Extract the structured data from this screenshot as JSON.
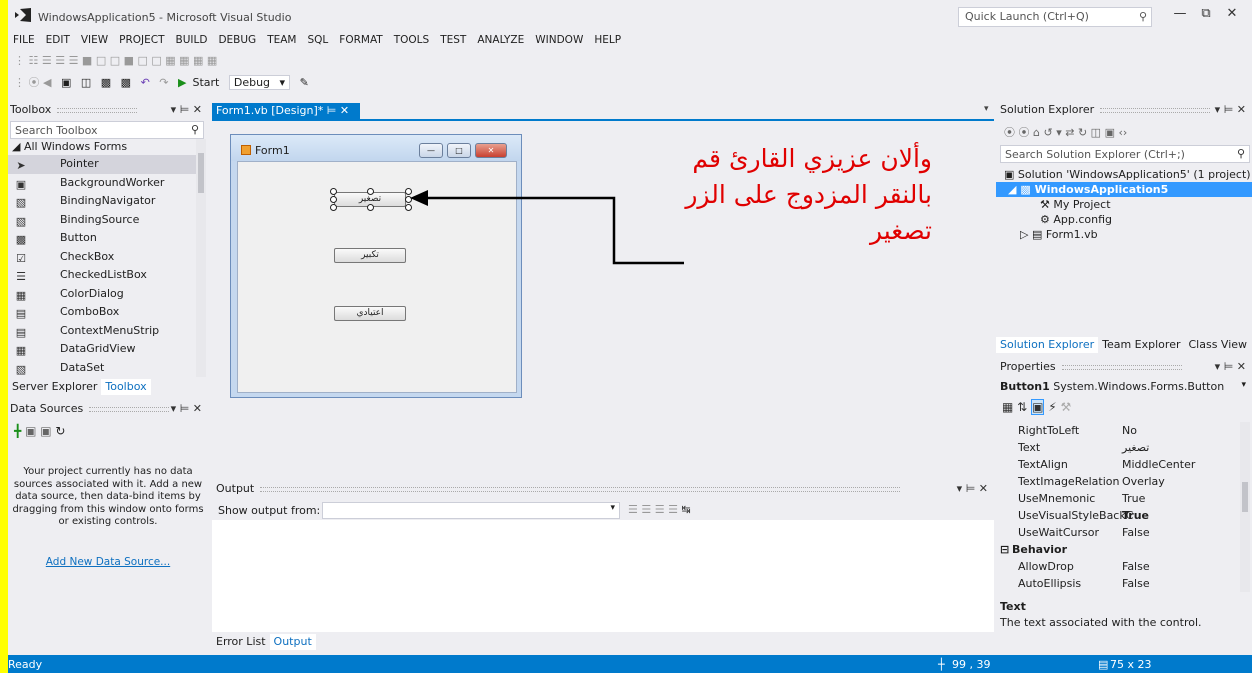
{
  "window": {
    "title": "WindowsApplication5 - Microsoft Visual Studio"
  },
  "quick_launch": {
    "placeholder": "Quick Launch (Ctrl+Q)"
  },
  "menu": [
    "FILE",
    "EDIT",
    "VIEW",
    "PROJECT",
    "BUILD",
    "DEBUG",
    "TEAM",
    "SQL",
    "FORMAT",
    "TOOLS",
    "TEST",
    "ANALYZE",
    "WINDOW",
    "HELP"
  ],
  "toolbar": {
    "start_label": "Start",
    "config_value": "Debug"
  },
  "toolbox": {
    "title": "Toolbox",
    "search_placeholder": "Search Toolbox",
    "group": "◢ All Windows Forms",
    "items": [
      "Pointer",
      "BackgroundWorker",
      "BindingNavigator",
      "BindingSource",
      "Button",
      "CheckBox",
      "CheckedListBox",
      "ColorDialog",
      "ComboBox",
      "ContextMenuStrip",
      "DataGridView",
      "DataSet"
    ],
    "tabs": [
      "Server Explorer",
      "Toolbox"
    ]
  },
  "data_sources": {
    "title": "Data Sources",
    "message": "Your project currently has no data sources associated with it. Add a new data source, then data-bind items by dragging from this window onto forms or existing controls.",
    "link": "Add New Data Source..."
  },
  "document_tab": {
    "label": "Form1.vb [Design]*"
  },
  "form": {
    "title": "Form1",
    "buttons": [
      "تصغير",
      "تكبير",
      "اعتيادي"
    ]
  },
  "annotation": {
    "line1": "وألان عزيزي القارئ قم",
    "line2": "بالنقر المزدوج على الزر",
    "line3": "تصغير",
    "color": "#e00000"
  },
  "output": {
    "title": "Output",
    "show_from_label": "Show output from:",
    "tabs": [
      "Error List",
      "Output"
    ]
  },
  "solution_explorer": {
    "title": "Solution Explorer",
    "search_placeholder": "Search Solution Explorer (Ctrl+;)",
    "tree": [
      "Solution 'WindowsApplication5' (1 project)",
      "WindowsApplication5",
      "My Project",
      "App.config",
      "Form1.vb"
    ],
    "tabs": [
      "Solution Explorer",
      "Team Explorer",
      "Class View"
    ]
  },
  "properties": {
    "title": "Properties",
    "object": "Button1",
    "object_type": "System.Windows.Forms.Button",
    "rows": [
      {
        "k": "RightToLeft",
        "v": "No"
      },
      {
        "k": "Text",
        "v": "تصغير"
      },
      {
        "k": "TextAlign",
        "v": "MiddleCenter"
      },
      {
        "k": "TextImageRelation",
        "v": "Overlay"
      },
      {
        "k": "UseMnemonic",
        "v": "True"
      },
      {
        "k": "UseVisualStyleBackC",
        "v": "True"
      },
      {
        "k": "UseWaitCursor",
        "v": "False"
      }
    ],
    "category": "Behavior",
    "rows2": [
      {
        "k": "AllowDrop",
        "v": "False"
      },
      {
        "k": "AutoEllipsis",
        "v": "False"
      }
    ],
    "desc_title": "Text",
    "desc_text": "The text associated with the control."
  },
  "status": {
    "text": "Ready",
    "position": "99 , 39",
    "size": "75 x 23"
  },
  "colors": {
    "accent": "#007acc",
    "background": "#eeeef2",
    "highlight": "#ffff00"
  }
}
